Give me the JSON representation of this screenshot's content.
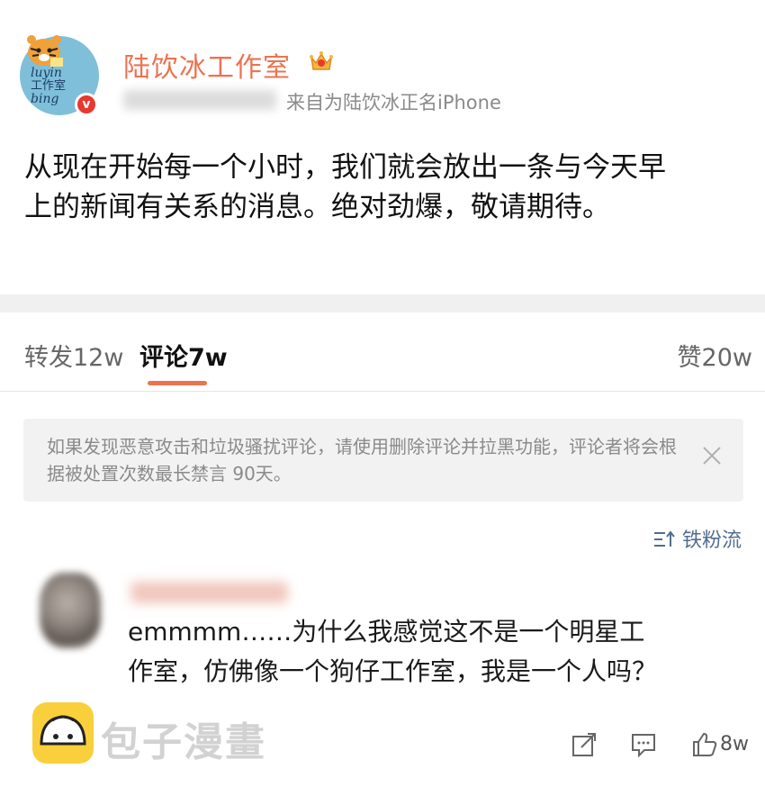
{
  "post": {
    "account_name": "陆饮冰工作室",
    "avatar_text_line1": "luyin",
    "avatar_text_line2": "bing",
    "avatar_text_line3": "工作室",
    "source": "来自为陆饮冰正名iPhone",
    "content": "从现在开始每一个小时，我们就会放出一条与今天早\n上的新闻有关系的消息。绝对劲爆，敬请期待。",
    "verified_mark": "v"
  },
  "tabs": {
    "repost": "转发12w",
    "comment": "评论7w",
    "like": "赞20w"
  },
  "notice": {
    "text": "如果发现恶意攻击和垃圾骚扰评论，请使用删除评论并拉黑功能，评论者将会根据被处置次数最长禁言 90天。"
  },
  "sort": {
    "label": "铁粉流"
  },
  "comment": {
    "text": "emmmm……为什么我感觉这不是一个明星工作室，仿佛像一个狗仔工作室，我是一个人吗？",
    "like_count": "8w"
  },
  "watermark": {
    "text": "包子漫畫"
  },
  "colors": {
    "accent": "#eb7350",
    "link": "#506e8f",
    "verified": "#e8382f"
  }
}
